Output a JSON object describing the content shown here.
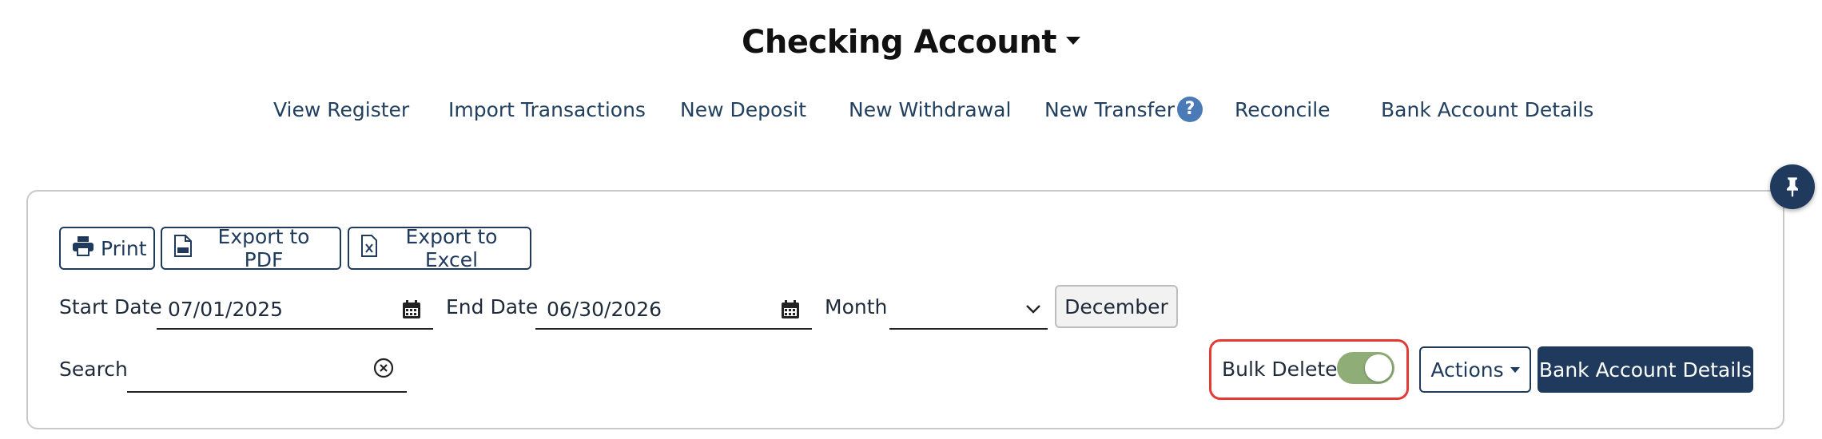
{
  "header": {
    "title": "Checking Account",
    "title_caret_icon": "caret-down-icon"
  },
  "nav": {
    "view_register": "View Register",
    "import_transactions": "Import Transactions",
    "new_deposit": "New Deposit",
    "new_withdrawal": "New Withdrawal",
    "new_transfer": "New Transfer",
    "help_badge": "?",
    "reconcile": "Reconcile",
    "bank_account_details": "Bank Account Details"
  },
  "toolbar": {
    "print_label": "Print",
    "export_pdf_label": "Export to PDF",
    "export_excel_label": "Export to Excel"
  },
  "filters": {
    "start_date_label": "Start Date",
    "start_date_value": "07/01/2025",
    "end_date_label": "End Date",
    "end_date_value": "06/30/2026",
    "month_label": "Month",
    "month_value": "",
    "month_button": "December",
    "search_label": "Search",
    "search_value": ""
  },
  "actions": {
    "bulk_delete_label": "Bulk Delete",
    "bulk_delete_on": true,
    "actions_label": "Actions",
    "bank_account_details_label": "Bank Account Details"
  },
  "colors": {
    "primary": "#1f3a5c",
    "link": "#22405f",
    "help_badge": "#4a7bb6",
    "toggle_on": "#8fae77",
    "highlight_border": "#e53935"
  }
}
